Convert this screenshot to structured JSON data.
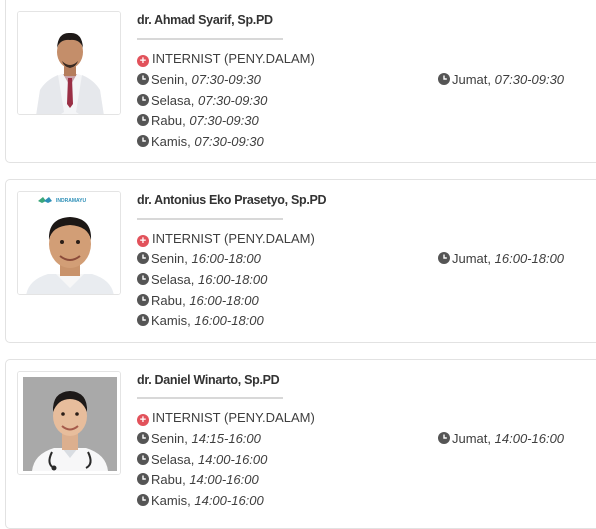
{
  "doctors": [
    {
      "name": "dr. Ahmad Syarif, Sp.PD",
      "specialty": "INTERNIST (PENY.DALAM)",
      "schedule_left": [
        {
          "day": "Senin",
          "time": "07:30-09:30"
        },
        {
          "day": "Selasa",
          "time": "07:30-09:30"
        },
        {
          "day": "Rabu",
          "time": "07:30-09:30"
        },
        {
          "day": "Kamis",
          "time": "07:30-09:30"
        }
      ],
      "schedule_right": [
        {
          "day": "Jumat",
          "time": "07:30-09:30"
        }
      ]
    },
    {
      "name": "dr. Antonius Eko Prasetyo, Sp.PD",
      "specialty": "INTERNIST (PENY.DALAM)",
      "photo_logo": "INDRAMAYU",
      "schedule_left": [
        {
          "day": "Senin",
          "time": "16:00-18:00"
        },
        {
          "day": "Selasa",
          "time": "16:00-18:00"
        },
        {
          "day": "Rabu",
          "time": "16:00-18:00"
        },
        {
          "day": "Kamis",
          "time": "16:00-18:00"
        }
      ],
      "schedule_right": [
        {
          "day": "Jumat",
          "time": "16:00-18:00"
        }
      ]
    },
    {
      "name": "dr. Daniel Winarto, Sp.PD",
      "specialty": "INTERNIST (PENY.DALAM)",
      "schedule_left": [
        {
          "day": "Senin",
          "time": "14:15-16:00"
        },
        {
          "day": "Selasa",
          "time": "14:00-16:00"
        },
        {
          "day": "Rabu",
          "time": "14:00-16:00"
        },
        {
          "day": "Kamis",
          "time": "14:00-16:00"
        }
      ],
      "schedule_right": [
        {
          "day": "Jumat",
          "time": "14:00-16:00"
        }
      ]
    }
  ],
  "icons": {
    "specialty": "plus-circle-icon",
    "schedule": "clock-icon"
  },
  "colors": {
    "specialty_icon": "#e2525b",
    "clock_icon": "#555555",
    "border": "#e2e2e2"
  }
}
